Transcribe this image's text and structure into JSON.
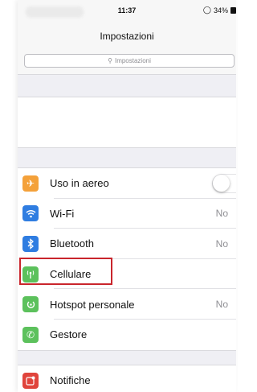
{
  "status_bar": {
    "time": "11:37",
    "battery": "34%"
  },
  "nav": {
    "title": "Impostazioni"
  },
  "search": {
    "placeholder": "Impostazioni"
  },
  "settings_group": [
    {
      "label": "Uso in aereo",
      "icon": "airplane-icon",
      "color": "#f4a13a",
      "toggle": "off"
    },
    {
      "label": "Wi-Fi",
      "icon": "wifi-icon",
      "color": "#2f7de1",
      "value": "No"
    },
    {
      "label": "Bluetooth",
      "icon": "bluetooth-icon",
      "color": "#2f7de1",
      "value": "No"
    },
    {
      "label": "Cellulare",
      "icon": "cellular-icon",
      "color": "#5cc15c",
      "highlighted": true
    },
    {
      "label": "Hotspot personale",
      "icon": "hotspot-icon",
      "color": "#5cc15c",
      "value": "No"
    },
    {
      "label": "Gestore",
      "icon": "phone-icon",
      "color": "#5cc15c"
    }
  ],
  "notifications_group": [
    {
      "label": "Notifiche",
      "icon": "notifications-icon",
      "color": "#e0443c"
    }
  ],
  "highlight_color": "#c9252c"
}
